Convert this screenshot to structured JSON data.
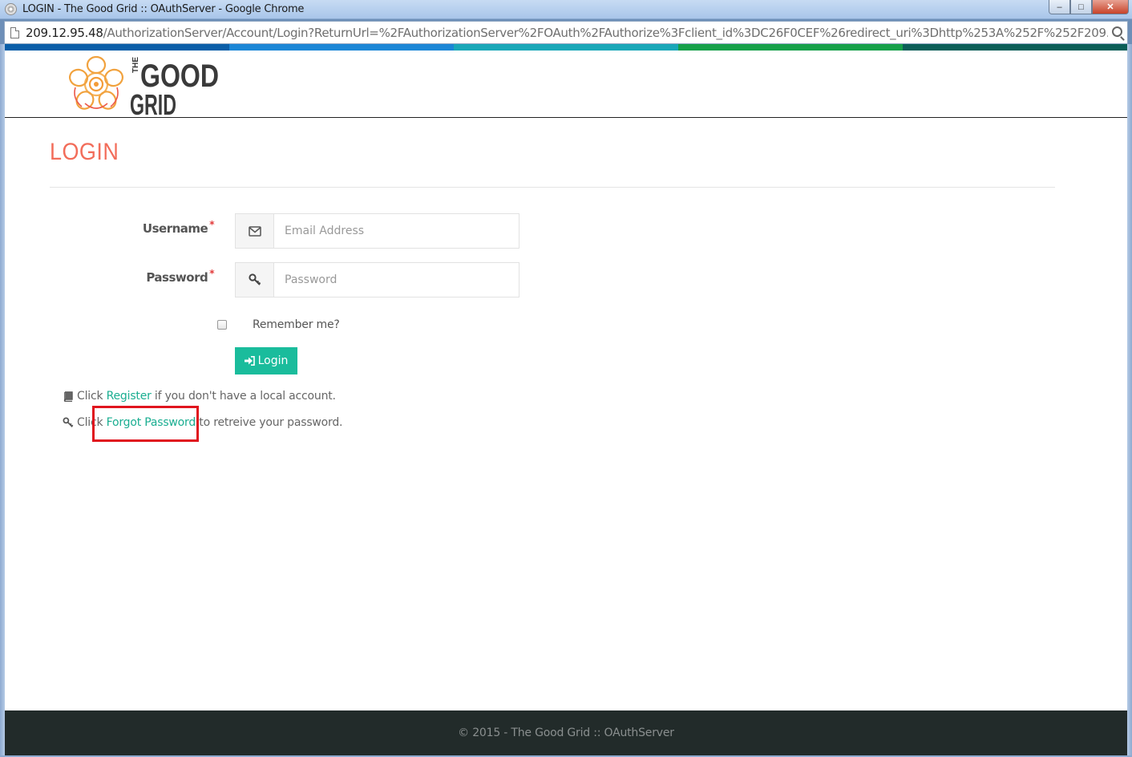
{
  "window": {
    "title": "LOGIN - The Good Grid :: OAuthServer - Google Chrome",
    "controls": {
      "minimize": "–",
      "maximize": "□",
      "close": "✕"
    }
  },
  "address_bar": {
    "host": "209.12.95.48",
    "path": "/AuthorizationServer/Account/Login?ReturnUrl=%2FAuthorizationServer%2FOAuth%2FAuthorize%3Fclient_id%3DC26F0CEF%26redirect_uri%3Dhttp%253A%252F%252F209.12.95."
  },
  "color_strip": [
    "#0a5ea8",
    "#1b86d6",
    "#1aa7b8",
    "#16a04a",
    "#0b5e58"
  ],
  "logo": {
    "word_the": "THE",
    "word_good": "GOOD",
    "word_grid": "GRID"
  },
  "page": {
    "title": "LOGIN",
    "username_label": "Username",
    "password_label": "Password",
    "required_mark": "*",
    "username_placeholder": "Email Address",
    "password_placeholder": "Password",
    "remember_label": "Remember me?",
    "login_button": "Login"
  },
  "help": {
    "register_prefix": "Click ",
    "register_link": "Register",
    "register_suffix": " if you don't have a local account.",
    "forgot_prefix": "Click ",
    "forgot_link": "Forgot Password",
    "forgot_suffix": " to retreive your password."
  },
  "footer": {
    "text": "© 2015 - The Good Grid :: OAuthServer"
  },
  "colors": {
    "accent": "#1abc9c",
    "title": "#f26d5a",
    "highlight": "#e0141e",
    "footer_bg": "#222b2a"
  }
}
